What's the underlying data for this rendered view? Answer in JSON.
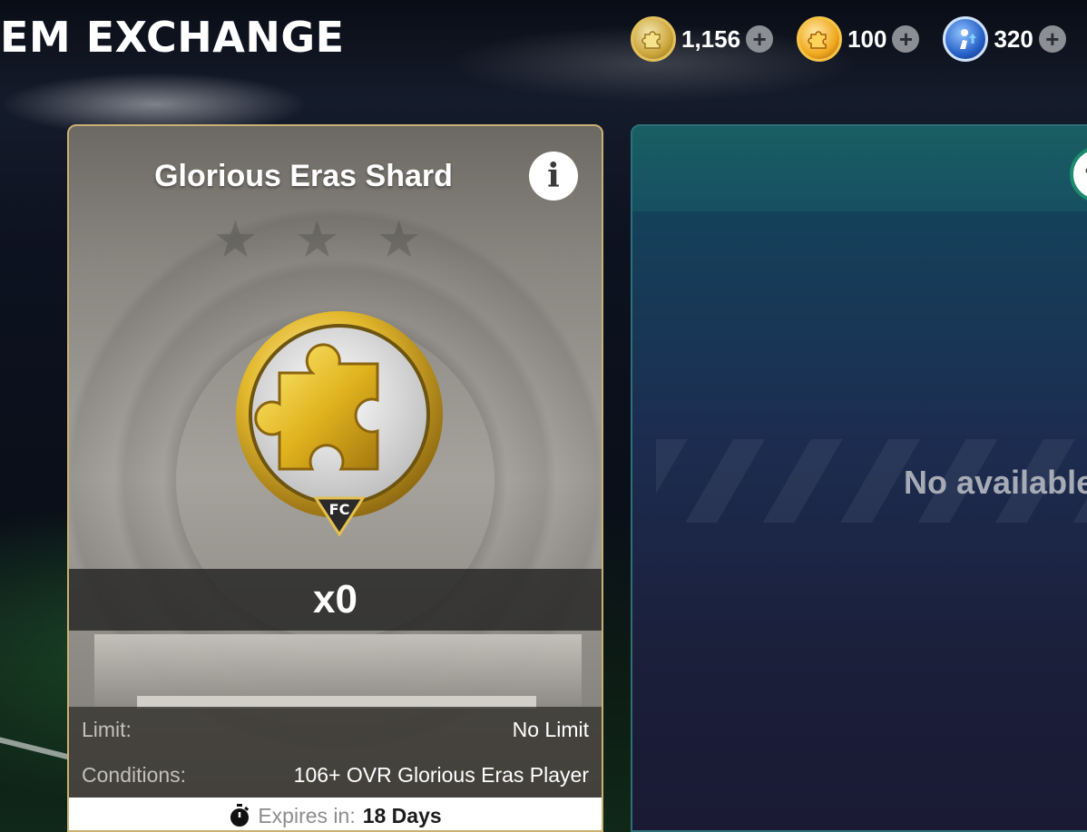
{
  "header": {
    "title": "EM EXCHANGE"
  },
  "currencies": [
    {
      "value": "1,156",
      "icon": "gold-puzzle-coin-icon"
    },
    {
      "value": "100",
      "icon": "orange-puzzle-coin-icon"
    },
    {
      "value": "320",
      "icon": "blue-player-upgrade-icon"
    }
  ],
  "card": {
    "title": "Glorious Eras Shard",
    "count": "x0",
    "limit_label": "Limit:",
    "limit_value": "No Limit",
    "conditions_label": "Conditions:",
    "conditions_value": "106+ OVR Glorious Eras Player",
    "expires_label": "Expires in:",
    "expires_value": "18 Days",
    "emblem_logo_text": "FC"
  },
  "card2": {
    "message": "No available"
  },
  "colors": {
    "card_border": "#c9b173",
    "card2_border": "#2f6f78",
    "shard_gold": "#e3b92c"
  }
}
